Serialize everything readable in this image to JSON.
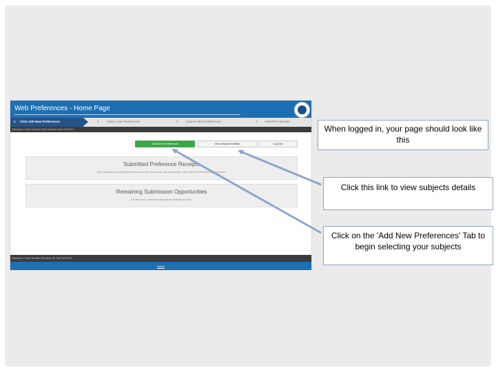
{
  "screenshot": {
    "header_title": "Web Preferences - Home Page",
    "steps": [
      {
        "number": "1",
        "label": "Click Add New Preferences"
      },
      {
        "number": "2",
        "label": "Select Your Preferences"
      },
      {
        "number": "3",
        "label": "Submit Valid Preferences"
      },
      {
        "number": "4",
        "label": "View/Print Receipt"
      }
    ],
    "student_bar": "Welcome: Dale Student  Test Student  Year 09 2013",
    "buttons": {
      "add": "Add New Preferences",
      "view": "View Subject Details",
      "logout": "Log Out"
    },
    "panels": [
      {
        "title": "Submitted Preference Receipts",
        "text": "Your completed (submitted) preferences can be viewed with your submission. Click 'Add New Preferences' to proceed."
      },
      {
        "title": "Remaining Submission Opportunities",
        "text": "You still have 3 submission(s) before submissions close."
      }
    ],
    "footer_info": "Welcome: Pass Student  Student ID  Year 09 2013",
    "footer_link": "Home"
  },
  "callouts": {
    "logged_in": "When logged in, your page should look like this",
    "subjects_link": "Click this link to view subjects details",
    "add_tab": "Click on the 'Add New Preferences' Tab to begin selecting your subjects"
  },
  "colors": {
    "header_blue": "#1d6fb3",
    "step_active": "#24538a",
    "add_button_green": "#3fa548",
    "arrow": "#8aa6cc"
  }
}
